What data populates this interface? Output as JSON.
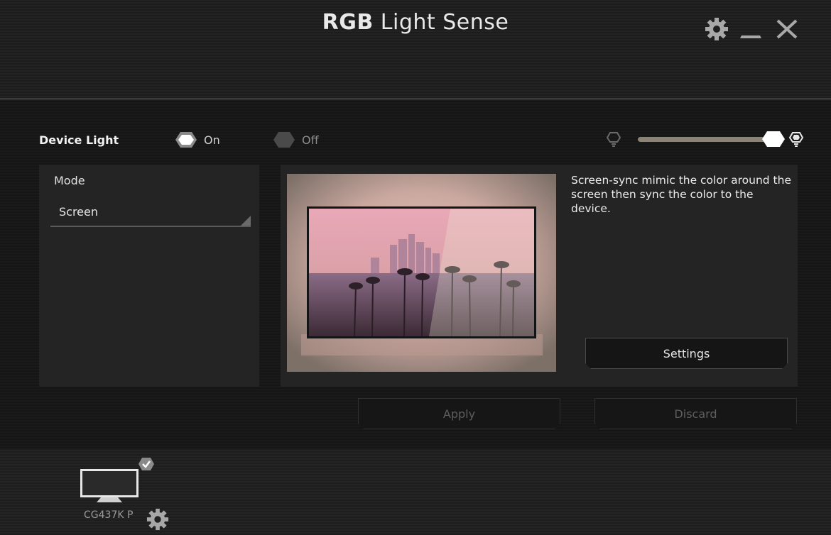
{
  "app": {
    "title_bold": "RGB",
    "title_rest": " Light Sense"
  },
  "window_controls": {
    "settings_icon": "gear-icon",
    "minimize_icon": "minimize-icon",
    "close_icon": "close-icon"
  },
  "device_light": {
    "label": "Device Light",
    "on_label": "On",
    "off_label": "Off",
    "selected": "On"
  },
  "brightness": {
    "min_icon": "bulb-dim-icon",
    "max_icon": "bulb-bright-icon",
    "level_percent": 93
  },
  "mode": {
    "label": "Mode",
    "selected": "Screen"
  },
  "preview": {
    "description": "Screen-sync mimic the color around the screen then sync the color to the device."
  },
  "buttons": {
    "settings": "Settings",
    "apply": "Apply",
    "discard": "Discard"
  },
  "device": {
    "name": "CG437K P",
    "icon": "monitor-icon",
    "badge": "check-icon",
    "settings_icon": "gear-icon"
  },
  "colors": {
    "accent": "#8a8060",
    "slider": "#8b8474",
    "background": "#141414"
  }
}
